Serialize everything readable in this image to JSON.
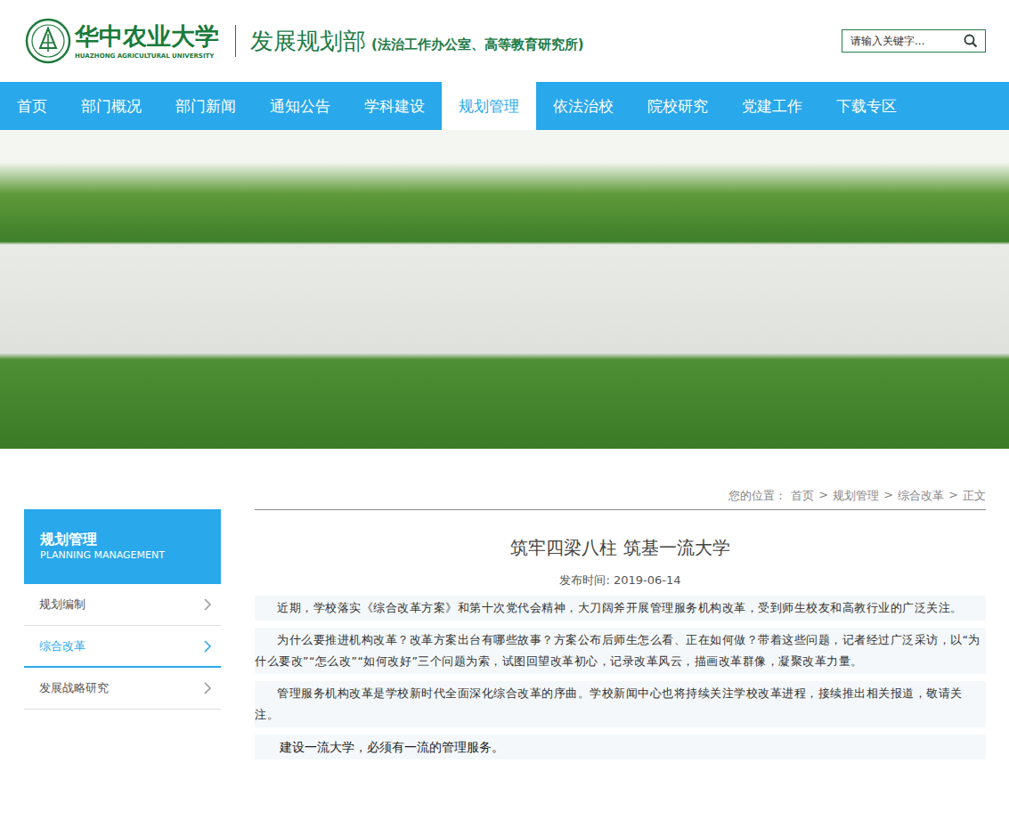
{
  "header": {
    "logo": {
      "name": "华中农业大学",
      "english": "HUAZHONG AGRICULTURAL UNIVERSITY"
    },
    "department": "发展规划部",
    "subtitle": "(法治工作办公室、高等教育研究所)",
    "search": {
      "placeholder": "请输入关键字..."
    }
  },
  "nav": [
    {
      "label": "首页",
      "selected": false
    },
    {
      "label": "部门概况",
      "selected": false
    },
    {
      "label": "部门新闻",
      "selected": false
    },
    {
      "label": "通知公告",
      "selected": false
    },
    {
      "label": "学科建设",
      "selected": false
    },
    {
      "label": "规划管理",
      "selected": true
    },
    {
      "label": "依法治校",
      "selected": false
    },
    {
      "label": "院校研究",
      "selected": false
    },
    {
      "label": "党建工作",
      "selected": false
    },
    {
      "label": "下载专区",
      "selected": false
    }
  ],
  "breadcrumb": {
    "label": "您的位置：",
    "items": [
      "首页",
      "规划管理",
      "综合改革",
      "正文"
    ],
    "separator": ">"
  },
  "sidebar": {
    "title": "规划管理",
    "subtitle": "PLANNING MANAGEMENT",
    "items": [
      {
        "label": "规划编制",
        "selected": false
      },
      {
        "label": "综合改革",
        "selected": true
      },
      {
        "label": "发展战略研究",
        "selected": false
      }
    ]
  },
  "article": {
    "title": "筑牢四梁八柱 筑基一流大学",
    "date_label": "发布时间: ",
    "date": "2019-06-14",
    "paragraphs": [
      {
        "kind": "body",
        "text": "近期，学校落实《综合改革方案》和第十次党代会精神，大刀阔斧开展管理服务机构改革，受到师生校友和高教行业的广泛关注。"
      },
      {
        "kind": "body",
        "text": "为什么要推进机构改革？改革方案出台有哪些故事？方案公布后师生怎么看、正在如何做？带着这些问题，记者经过广泛采访，以“为什么要改”“怎么改”“如何改好”三个问题为索，试图回望改革初心，记录改革风云，描画改革群像，凝聚改革力量。"
      },
      {
        "kind": "body",
        "text": "管理服务机构改革是学校新时代全面深化综合改革的序曲。学校新闻中心也将持续关注学校改革进程，接续推出相关报道，敬请关注。"
      },
      {
        "kind": "lead",
        "text": "建设一流大学，必须有一流的管理服务。"
      }
    ]
  }
}
